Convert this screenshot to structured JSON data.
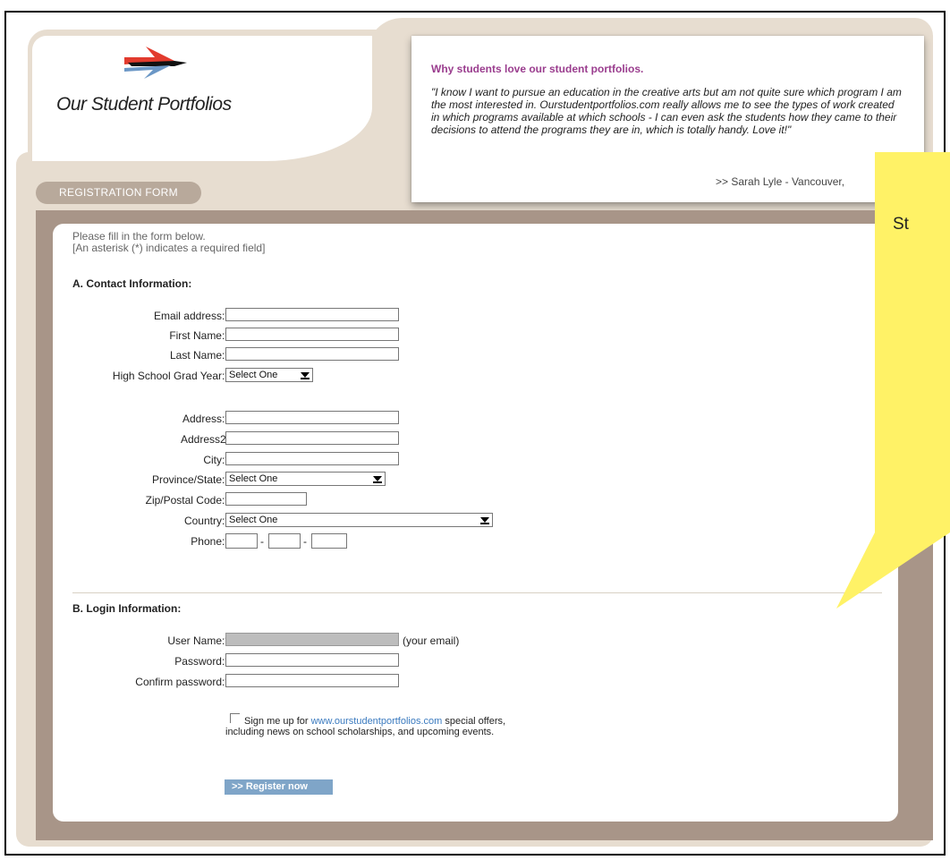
{
  "brand": {
    "name": "Our Student Portfolios"
  },
  "header": {
    "form_badge": "REGISTRATION FORM",
    "quote_title": "Why students love our student portfolios.",
    "quote_text": "\"I know I want to pursue an education in the creative arts but am not quite sure which program I am the most interested in. Ourstudentportfolios.com really allows me to see the types of work created in which programs available at which schools - I can even ask the students how they came to their decisions to attend the programs they are in, which is totally handy. Love it!\"",
    "quote_author": ">> Sarah Lyle - Vancouver,"
  },
  "intro": {
    "line1": "Please fill in the form below.",
    "line2": "[An asterisk (*) indicates a required field]"
  },
  "contact": {
    "title": "A. Contact Information:",
    "email_label": "Email address:*",
    "first_name_label": "First Name:*",
    "last_name_label": "Last Name:*",
    "grad_year_label": "High School Grad Year:*",
    "grad_year_value": "Select One",
    "address_label": "Address:*",
    "address2_label": "Address2:",
    "city_label": "City:*",
    "province_label": "Province/State:*",
    "province_value": "Select One",
    "zip_label": "Zip/Postal Code:*",
    "country_label": "Country:*",
    "country_value": "Select One",
    "phone_label": "Phone:*",
    "phone_sep": "-"
  },
  "login": {
    "title": "B. Login Information:",
    "username_label": "User Name:*",
    "username_hint": "(your email)",
    "password_label": "Password:*",
    "confirm_label": "Confirm password:*"
  },
  "signup": {
    "text_before": "Sign me up for ",
    "link": "www.ourstudentportfolios.com",
    "text_after": " special offers,",
    "line2": "including news on school scholarships, and upcoming events."
  },
  "register_button": ">>  Register now",
  "callout": {
    "text": "St"
  },
  "colors": {
    "beige": "#e7ddd0",
    "brown": "#a89588",
    "accent_purple": "#9a3d8e",
    "link_blue": "#3a7abf",
    "button_blue": "#7fa5c8",
    "callout_yellow": "#fff266"
  }
}
